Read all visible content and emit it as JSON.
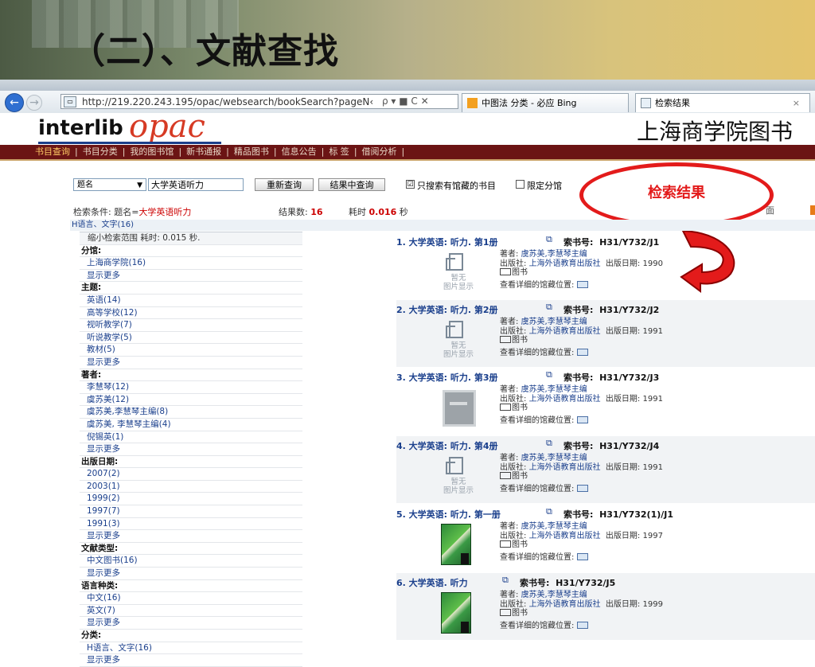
{
  "slide": {
    "title": "（二）、文献查找"
  },
  "browser": {
    "url": "http://219.220.243.195/opac/websearch/bookSearch?pageN‹",
    "url_tools": "ρ ▾ ■ C ✕",
    "tabs": [
      {
        "label": "中图法 分类 - 必应 Bing"
      },
      {
        "label": "检索结果",
        "close": "×"
      }
    ]
  },
  "header": {
    "logo_left": "interlib",
    "logo_right": "opac",
    "library_name": "上海商学院图书"
  },
  "menu": [
    "书目查询",
    "|",
    "书目分类",
    "|",
    "我的图书馆",
    "|",
    "新书通报",
    "|",
    "精品图书",
    "|",
    "信息公告",
    "|",
    "标 签",
    "|",
    "借阅分析",
    "|"
  ],
  "search": {
    "field": "题名",
    "query": "大学英语听力",
    "requery_label": "重新查询",
    "within_label": "结果中查询",
    "only_holdings_label": "只搜索有馆藏的书目",
    "only_holdings_checked": "☑",
    "limit_class_label": "限定分馆"
  },
  "conditions": {
    "label": "检索条件:",
    "field": "题名=",
    "value": "大学英语听力",
    "count_label": "结果数:",
    "count": "16",
    "time_label": "耗时",
    "time": "0.016",
    "time_unit": "秒"
  },
  "callout": {
    "text": "检索结果"
  },
  "right_edge_text": "面",
  "breadcrumb": "H语言、文字(16)",
  "facets": [
    {
      "kind": "narrow",
      "text": "缩小检索范围 耗时: 0.015 秒."
    },
    {
      "kind": "head",
      "text": "分馆:"
    },
    {
      "kind": "link",
      "text": "上海商学院(16)"
    },
    {
      "kind": "more",
      "text": "显示更多"
    },
    {
      "kind": "head",
      "text": "主题:"
    },
    {
      "kind": "link",
      "text": "英语(14)"
    },
    {
      "kind": "link",
      "text": "高等学校(12)"
    },
    {
      "kind": "link",
      "text": "视听教学(7)"
    },
    {
      "kind": "link",
      "text": "听说教学(5)"
    },
    {
      "kind": "link",
      "text": "教材(5)"
    },
    {
      "kind": "more",
      "text": "显示更多"
    },
    {
      "kind": "head",
      "text": "著者:"
    },
    {
      "kind": "link",
      "text": "李慧琴(12)"
    },
    {
      "kind": "link",
      "text": "虞苏美(12)"
    },
    {
      "kind": "link",
      "text": "虞苏美,李慧琴主编(8)"
    },
    {
      "kind": "link",
      "text": "虞苏美, 李慧琴主编(4)"
    },
    {
      "kind": "link",
      "text": "倪锡英(1)"
    },
    {
      "kind": "more",
      "text": "显示更多"
    },
    {
      "kind": "head",
      "text": "出版日期:"
    },
    {
      "kind": "link",
      "text": "2007(2)"
    },
    {
      "kind": "link",
      "text": "2003(1)"
    },
    {
      "kind": "link",
      "text": "1999(2)"
    },
    {
      "kind": "link",
      "text": "1997(7)"
    },
    {
      "kind": "link",
      "text": "1991(3)"
    },
    {
      "kind": "more",
      "text": "显示更多"
    },
    {
      "kind": "head",
      "text": "文献类型:"
    },
    {
      "kind": "link",
      "text": "中文图书(16)"
    },
    {
      "kind": "more",
      "text": "显示更多"
    },
    {
      "kind": "head",
      "text": "语言种类:"
    },
    {
      "kind": "link",
      "text": "中文(16)"
    },
    {
      "kind": "link",
      "text": "英文(7)"
    },
    {
      "kind": "more",
      "text": "显示更多"
    },
    {
      "kind": "head",
      "text": "分类:"
    },
    {
      "kind": "link",
      "text": "H语言、文字(16)"
    },
    {
      "kind": "more",
      "text": "显示更多"
    }
  ],
  "results": [
    {
      "title": "1. 大学英语: 听力. 第1册",
      "call_label": "索书号:",
      "call_no": "H31/Y732/J1",
      "author_label": "著者:",
      "author": "虞苏美,李慧琴主编",
      "publisher_label": "出版社:",
      "publisher": "上海外语教育出版社",
      "date_label": "出版日期:",
      "date": "1990",
      "type": "图书",
      "loc_label": "查看详细的馆藏位置:",
      "thumb": "none",
      "no_cover": "暂无\n图片显示"
    },
    {
      "title": "2. 大学英语: 听力. 第2册",
      "call_label": "索书号:",
      "call_no": "H31/Y732/J2",
      "author_label": "著者:",
      "author": "虞苏美,李慧琴主编",
      "publisher_label": "出版社:",
      "publisher": "上海外语教育出版社",
      "date_label": "出版日期:",
      "date": "1991",
      "type": "图书",
      "loc_label": "查看详细的馆藏位置:",
      "thumb": "none",
      "no_cover": "暂无\n图片显示"
    },
    {
      "title": "3. 大学英语: 听力. 第3册",
      "call_label": "索书号:",
      "call_no": "H31/Y732/J3",
      "author_label": "著者:",
      "author": "虞苏美,李慧琴主编",
      "publisher_label": "出版社:",
      "publisher": "上海外语教育出版社",
      "date_label": "出版日期:",
      "date": "1991",
      "type": "图书",
      "loc_label": "查看详细的馆藏位置:",
      "thumb": "gray",
      "no_cover": ""
    },
    {
      "title": "4. 大学英语: 听力. 第4册",
      "call_label": "索书号:",
      "call_no": "H31/Y732/J4",
      "author_label": "著者:",
      "author": "虞苏美,李慧琴主编",
      "publisher_label": "出版社:",
      "publisher": "上海外语教育出版社",
      "date_label": "出版日期:",
      "date": "1991",
      "type": "图书",
      "loc_label": "查看详细的馆藏位置:",
      "thumb": "none",
      "no_cover": "暂无\n图片显示"
    },
    {
      "title": "5. 大学英语: 听力. 第一册",
      "call_label": "索书号:",
      "call_no": "H31/Y732(1)/J1",
      "author_label": "著者:",
      "author": "虞苏美,李慧琴主编",
      "publisher_label": "出版社:",
      "publisher": "上海外语教育出版社",
      "date_label": "出版日期:",
      "date": "1997",
      "type": "图书",
      "loc_label": "查看详细的馆藏位置:",
      "thumb": "cover",
      "no_cover": ""
    },
    {
      "title": "6. 大学英语. 听力",
      "call_label": "索书号:",
      "call_no": "H31/Y732/J5",
      "author_label": "著者:",
      "author": "虞苏美,李慧琴主编",
      "publisher_label": "出版社:",
      "publisher": "上海外语教育出版社",
      "date_label": "出版日期:",
      "date": "1999",
      "type": "图书",
      "loc_label": "查看详细的馆藏位置:",
      "thumb": "cover",
      "no_cover": ""
    }
  ]
}
